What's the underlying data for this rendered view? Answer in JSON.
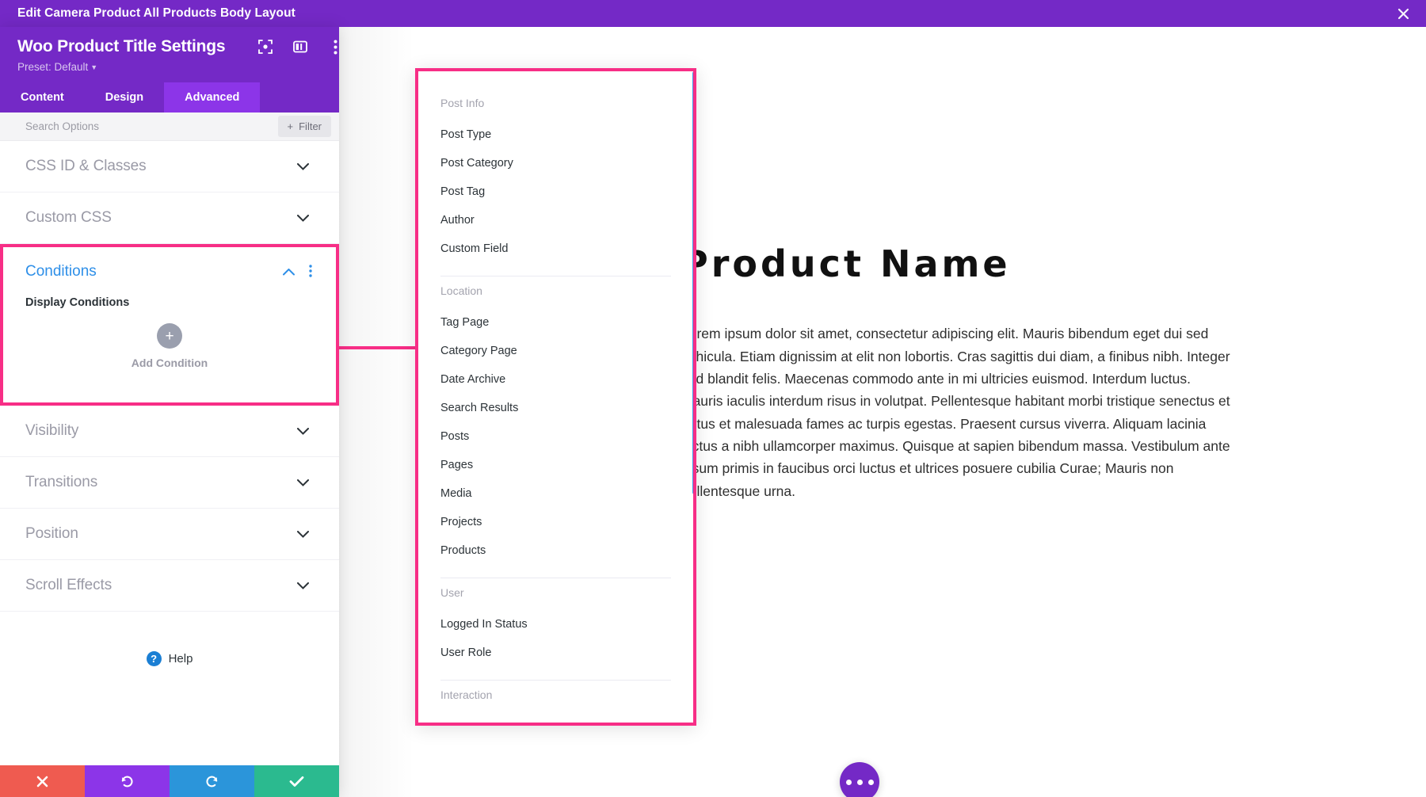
{
  "window": {
    "title": "Edit Camera Product All Products Body Layout",
    "close_icon": "close-icon"
  },
  "panel": {
    "title": "Woo Product Title Settings",
    "preset_label": "Preset: Default",
    "header_icons": [
      "focus-icon",
      "layout-columns-icon",
      "more-vertical-icon"
    ],
    "tabs": [
      {
        "label": "Content",
        "active": false
      },
      {
        "label": "Design",
        "active": false
      },
      {
        "label": "Advanced",
        "active": true
      }
    ],
    "search": {
      "placeholder": "Search Options",
      "value": ""
    },
    "filter_button": "Filter",
    "sections_above": [
      {
        "label": "CSS ID & Classes"
      },
      {
        "label": "Custom CSS"
      }
    ],
    "conditions": {
      "title": "Conditions",
      "sub_label": "Display Conditions",
      "add_label": "Add Condition",
      "expanded": true
    },
    "sections_below": [
      {
        "label": "Visibility"
      },
      {
        "label": "Transitions"
      },
      {
        "label": "Position"
      },
      {
        "label": "Scroll Effects"
      }
    ],
    "help_label": "Help",
    "actions": [
      {
        "name": "cancel",
        "glyph": "✖",
        "color": "#ef5b50"
      },
      {
        "name": "undo",
        "glyph": "↺",
        "color": "#8c35e8"
      },
      {
        "name": "redo",
        "glyph": "↻",
        "color": "#2b95da"
      },
      {
        "name": "save",
        "glyph": "✔",
        "color": "#2bba8f"
      }
    ]
  },
  "dropdown": {
    "groups": [
      {
        "label": "Post Info",
        "items": [
          "Post Type",
          "Post Category",
          "Post Tag",
          "Author",
          "Custom Field"
        ]
      },
      {
        "label": "Location",
        "items": [
          "Tag Page",
          "Category Page",
          "Date Archive",
          "Search Results",
          "Posts",
          "Pages",
          "Media",
          "Projects",
          "Products"
        ]
      },
      {
        "label": "User",
        "items": [
          "Logged In Status",
          "User Role"
        ]
      },
      {
        "label": "Interaction",
        "items": []
      }
    ]
  },
  "content": {
    "heading": "Product Name",
    "paragraph": "Lorem ipsum dolor sit amet, consectetur adipiscing elit. Mauris bibendum eget dui sed vehicula. Etiam dignissim at elit non lobortis. Cras sagittis dui diam, a finibus nibh. Integer sed blandit felis. Maecenas commodo ante in mi ultricies euismod. Interdum luctus. Mauris iaculis interdum risus in volutpat. Pellentesque habitant morbi tristique senectus et netus et malesuada fames ac turpis egestas. Praesent cursus viverra. Aliquam lacinia lectus a nibh ullamcorper maximus. Quisque at sapien bibendum massa. Vestibulum ante ipsum primis in faucibus orci luctus et ultrices posuere cubilia Curae; Mauris non pellentesque urna.",
    "fab_icon": "more-horizontal-icon"
  },
  "colors": {
    "brand_purple": "#7429c6",
    "tab_active": "#8c35e8",
    "highlight_pink": "#f72e86",
    "accent_blue": "#2e8fe8",
    "module_border_blue": "#3e9ae8"
  }
}
